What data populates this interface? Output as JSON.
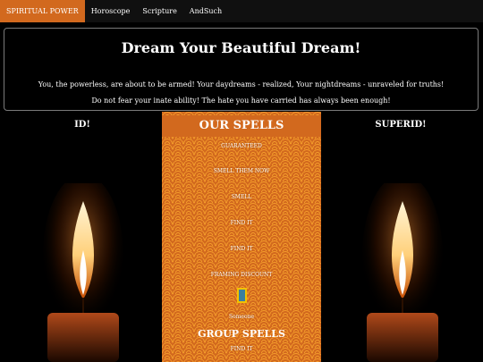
{
  "nav": {
    "items": [
      {
        "label": "SPIRITUAL POWER"
      },
      {
        "label": "Horoscope"
      },
      {
        "label": "Scripture"
      },
      {
        "label": "AndSuch"
      }
    ]
  },
  "banner": {
    "title": "Dream Your Beautiful Dream!",
    "line1": "You, the powerless, are about to be armed! Your daydreams - realized, Your nightdreams - unraveled for truths!",
    "line2": "Do not fear your inate ability! The hate you have carried has always been enough!"
  },
  "left_title": "ID!",
  "right_title": "SUPERID!",
  "spells": {
    "header": "OUR SPELLS",
    "items": [
      "GUARANTEED",
      "SMELL THEM NOW",
      "SMELL",
      "FIND IT",
      "FIND IT",
      "FRAMING DISCOUNT"
    ],
    "icon": "candle-card-icon",
    "icon_caption": "Someone",
    "group_header": "GROUP SPELLS",
    "group_item": "FIND IT"
  },
  "colors": {
    "accent": "#d2691e",
    "pattern": "#f29a2b"
  }
}
